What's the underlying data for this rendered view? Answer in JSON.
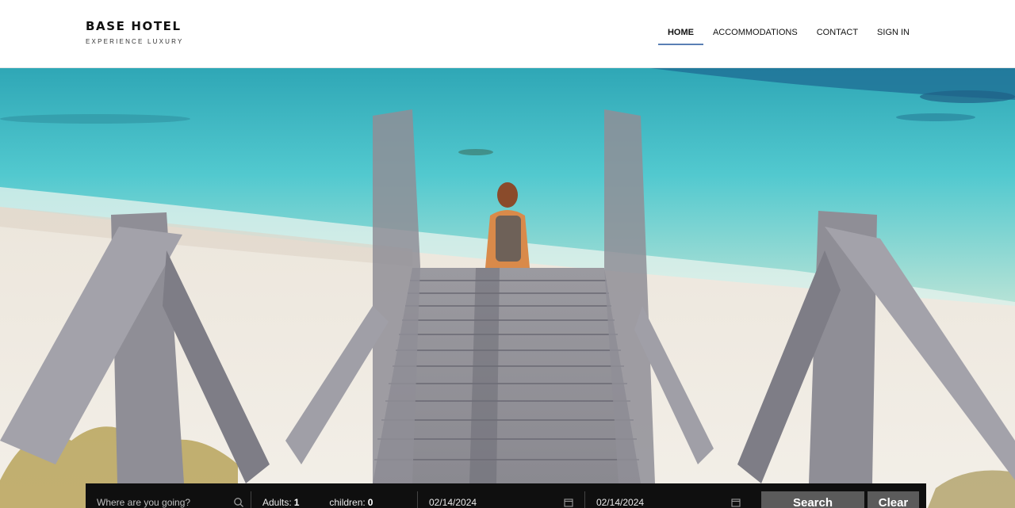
{
  "brand": {
    "title": "BASE HOTEL",
    "tagline": "EXPERIENCE LUXURY"
  },
  "nav": {
    "items": [
      "HOME",
      "ACCOMMODATIONS",
      "CONTACT",
      "SIGN IN"
    ],
    "active": "HOME",
    "accent_color": "#5a7fb5"
  },
  "hero": {
    "image_subject": "beach-boardwalk-photo"
  },
  "search": {
    "destination_placeholder": "Where are you going?",
    "adults_label": "Adults:",
    "adults_value": "1",
    "children_label": "children:",
    "children_value": "0",
    "check_in": "02/14/2024",
    "check_out": "02/14/2024",
    "search_button": "Search",
    "clear_button": "Clear",
    "bar_color": "#0f0f0f",
    "button_color": "#5b5b5b"
  }
}
